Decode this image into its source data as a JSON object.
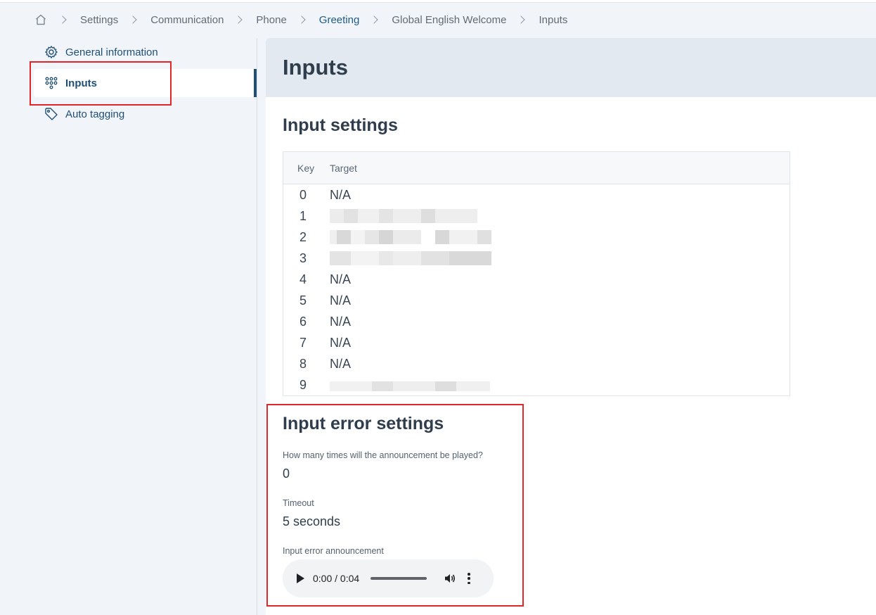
{
  "breadcrumb": {
    "items": [
      "Settings",
      "Communication",
      "Phone",
      "Greeting",
      "Global English Welcome",
      "Inputs"
    ],
    "active_index": 3
  },
  "sidebar": {
    "items": [
      {
        "label": "General information",
        "icon": "gear-icon"
      },
      {
        "label": "Inputs",
        "icon": "keypad-icon",
        "active": true
      },
      {
        "label": "Auto tagging",
        "icon": "tag-icon"
      }
    ]
  },
  "page": {
    "title": "Inputs",
    "input_settings_title": "Input settings",
    "table": {
      "headers": {
        "key": "Key",
        "target": "Target"
      },
      "rows": [
        {
          "key": "0",
          "target": "N/A"
        },
        {
          "key": "1",
          "target": ""
        },
        {
          "key": "2",
          "target": ""
        },
        {
          "key": "3",
          "target": ""
        },
        {
          "key": "4",
          "target": "N/A"
        },
        {
          "key": "5",
          "target": "N/A"
        },
        {
          "key": "6",
          "target": "N/A"
        },
        {
          "key": "7",
          "target": "N/A"
        },
        {
          "key": "8",
          "target": "N/A"
        },
        {
          "key": "9",
          "target": ""
        }
      ]
    },
    "error_settings": {
      "title": "Input error settings",
      "replay_label": "How many times will the announcement be played?",
      "replay_value": "0",
      "timeout_label": "Timeout",
      "timeout_value": "5 seconds",
      "announcement_label": "Input error announcement",
      "audio_time": "0:00 / 0:04"
    }
  },
  "colors": {
    "accent": "#1e4f75",
    "highlight_box": "#e0262b",
    "header_bg": "#e3e9f0"
  }
}
